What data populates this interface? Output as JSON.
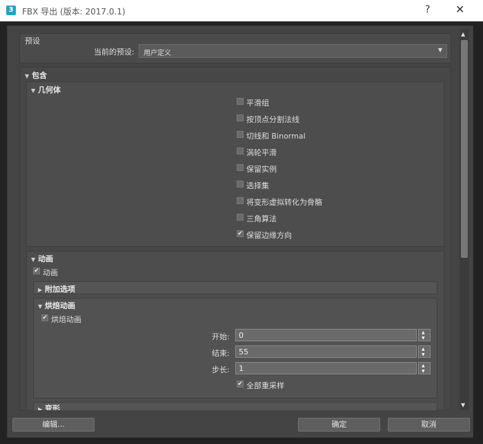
{
  "window": {
    "title": "FBX 导出 (版本: 2017.0.1)",
    "app_icon": "3",
    "help": "?",
    "close": "✕"
  },
  "presets": {
    "group_label": "预设",
    "current_label": "当前的预设:",
    "current_value": "用户定义"
  },
  "include": {
    "header": "包含",
    "geometry": {
      "header": "几何体",
      "options": [
        {
          "label": "平滑组",
          "checked": false
        },
        {
          "label": "按顶点分割法线",
          "checked": false
        },
        {
          "label": "切线和 Binormal",
          "checked": false
        },
        {
          "label": "涡轮平滑",
          "checked": false
        },
        {
          "label": "保留实例",
          "checked": false
        },
        {
          "label": "选择集",
          "checked": false
        },
        {
          "label": "将变形虚拟转化为骨骼",
          "checked": false
        },
        {
          "label": "三角算法",
          "checked": false
        },
        {
          "label": "保留边缘方向",
          "checked": true
        }
      ]
    },
    "animation": {
      "header": "动画",
      "enable_label": "动画",
      "enable_checked": true,
      "extra_header": "附加选项",
      "bake": {
        "header": "烘焙动画",
        "enable_label": "烘焙动画",
        "enable_checked": true,
        "start_label": "开始:",
        "start_value": "0",
        "end_label": "结束:",
        "end_value": "55",
        "step_label": "步长:",
        "step_value": "1",
        "resample_label": "全部重采样",
        "resample_checked": true
      },
      "deform_header": "变形"
    }
  },
  "buttons": {
    "edit": "编辑...",
    "ok": "确定",
    "cancel": "取消"
  },
  "glyphs": {
    "check": "✔",
    "expanded": "▼",
    "collapsed": "▶",
    "dd": "▼",
    "spin_up": "▲",
    "spin_down": "▼"
  }
}
